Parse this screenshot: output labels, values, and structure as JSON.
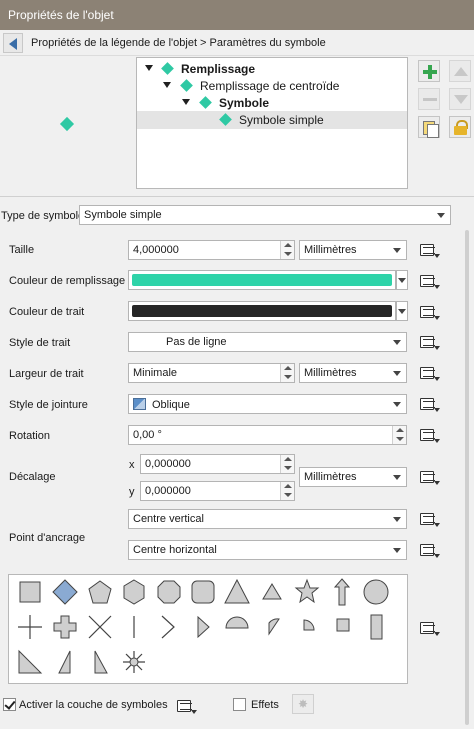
{
  "window": {
    "title": "Propriétés de l'objet"
  },
  "breadcrumb": {
    "text": "Propriétés de la légende de l'objet > Paramètres du symbole"
  },
  "tree": [
    {
      "label": "Remplissage",
      "bold": true,
      "level": 0
    },
    {
      "label": "Remplissage de centroïde",
      "bold": false,
      "level": 1
    },
    {
      "label": "Symbole",
      "bold": true,
      "level": 2
    },
    {
      "label": "Symbole simple",
      "bold": false,
      "level": 3
    }
  ],
  "symbol_type": {
    "label": "Type de symbole",
    "value": "Symbole simple"
  },
  "props": {
    "size": {
      "label": "Taille",
      "value": "4,000000",
      "unit": "Millimètres"
    },
    "fill_color": {
      "label": "Couleur de remplissage",
      "color": "#2ed3a8"
    },
    "stroke_color": {
      "label": "Couleur de trait",
      "color": "#262626"
    },
    "stroke_style": {
      "label": "Style de trait",
      "value": "Pas de ligne"
    },
    "stroke_width": {
      "label": "Largeur de trait",
      "value": "Minimale",
      "unit": "Millimètres"
    },
    "join_style": {
      "label": "Style de jointure",
      "value": "Oblique"
    },
    "rotation": {
      "label": "Rotation",
      "value": "0,00 °"
    },
    "offset": {
      "label": "Décalage",
      "x_label": "x",
      "x": "0,000000",
      "y_label": "y",
      "y": "0,000000",
      "unit": "Millimètres"
    },
    "anchor": {
      "label": "Point d'ancrage",
      "vertical": "Centre vertical",
      "horizontal": "Centre horizontal"
    }
  },
  "footer": {
    "layer_label": "Activer la couche de symboles",
    "layer_checked": true,
    "effects_label": "Effets",
    "effects_checked": false
  },
  "colors": {
    "accent": "#2fc9a4",
    "shape_fill": "#cfcfcf",
    "shape_selected": "#8aaad2"
  }
}
